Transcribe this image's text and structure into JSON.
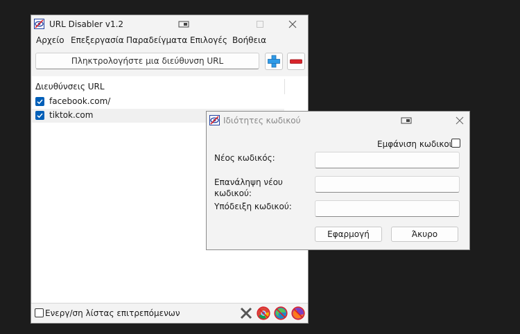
{
  "main_window": {
    "title": "URL Disabler v1.2",
    "menu": [
      "Αρχείο",
      "Επεξεργασία",
      "Παραδείγματα",
      "Επιλογές",
      "Βοήθεια"
    ],
    "url_input_placeholder": "Πληκτρολογήστε μια διεύθυνση URL",
    "list_header": "Διευθύνσεις URL",
    "urls": [
      {
        "text": "facebook.com/",
        "checked": true
      },
      {
        "text": "tiktok.com",
        "checked": true
      }
    ],
    "whitelist_checkbox_label": "Ενεργ/ση λίστας επιτρεπόμενων",
    "whitelist_checked": false,
    "status_icons": [
      "close-x-icon",
      "chrome-blocked-icon",
      "edge-blocked-icon",
      "firefox-blocked-icon"
    ]
  },
  "password_dialog": {
    "title": "Ιδιότητες κωδικού",
    "show_password_label": "Εμφάνιση κωδικού",
    "show_password_checked": false,
    "new_password_label": "Νέος κωδικός:",
    "repeat_password_label": "Επανάληψη νέου κωδικού:",
    "hint_label": "Υπόδειξη κωδικού:",
    "apply_button": "Εφαρμογή",
    "cancel_button": "Άκυρο"
  },
  "colors": {
    "accent": "#005fb8",
    "add_button_blue": "#2f9be8",
    "remove_button_red": "#d8232a",
    "desktop": "#1c1c1c"
  }
}
